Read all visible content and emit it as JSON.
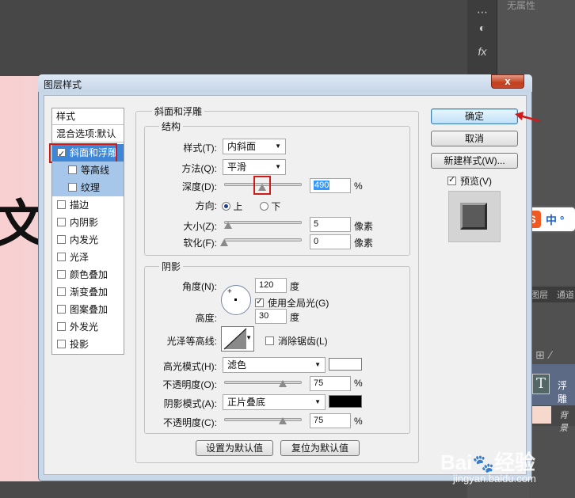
{
  "background": {
    "properties_label": "无属性",
    "canvas_char": "文",
    "panel_tabs": [
      "图层",
      "通道"
    ],
    "layer_name": "浮雕",
    "layer2_name": "背景",
    "sogou_text": "中 °"
  },
  "dialog": {
    "title": "图层样式",
    "close": "x",
    "styles_list": {
      "header": "样式",
      "blend_options": "混合选项:默认",
      "items": [
        {
          "label": "斜面和浮雕",
          "checked": true
        },
        {
          "label": "等高线",
          "checked": false
        },
        {
          "label": "纹理",
          "checked": false
        },
        {
          "label": "描边",
          "checked": false
        },
        {
          "label": "内阴影",
          "checked": false
        },
        {
          "label": "内发光",
          "checked": false
        },
        {
          "label": "光泽",
          "checked": false
        },
        {
          "label": "颜色叠加",
          "checked": false
        },
        {
          "label": "渐变叠加",
          "checked": false
        },
        {
          "label": "图案叠加",
          "checked": false
        },
        {
          "label": "外发光",
          "checked": false
        },
        {
          "label": "投影",
          "checked": false
        }
      ]
    },
    "bevel": {
      "section_title": "斜面和浮雕",
      "structure": {
        "title": "结构",
        "style_label": "样式(T):",
        "style_value": "内斜面",
        "technique_label": "方法(Q):",
        "technique_value": "平滑",
        "depth_label": "深度(D):",
        "depth_value": "490",
        "depth_unit": "%",
        "depth_slider_fraction": 0.49,
        "direction_label": "方向:",
        "direction_up": "上",
        "direction_down": "下",
        "direction_selected": "上",
        "size_label": "大小(Z):",
        "size_value": "5",
        "size_unit": "像素",
        "soften_label": "软化(F):",
        "soften_value": "0",
        "soften_unit": "像素"
      },
      "shading": {
        "title": "阴影",
        "angle_label": "角度(N):",
        "angle_value": "120",
        "angle_unit": "度",
        "global_light_label": "使用全局光(G)",
        "global_light_checked": true,
        "altitude_label": "高度:",
        "altitude_value": "30",
        "altitude_unit": "度",
        "gloss_contour_label": "光泽等高线:",
        "anti_alias_label": "消除锯齿(L)",
        "anti_alias_checked": false,
        "highlight_mode_label": "高光模式(H):",
        "highlight_mode_value": "滤色",
        "highlight_color": "#ffffff",
        "highlight_opacity_label": "不透明度(O):",
        "highlight_opacity_value": "75",
        "highlight_opacity_unit": "%",
        "shadow_mode_label": "阴影模式(A):",
        "shadow_mode_value": "正片叠底",
        "shadow_color": "#000000",
        "shadow_opacity_label": "不透明度(C):",
        "shadow_opacity_value": "75",
        "shadow_opacity_unit": "%"
      },
      "make_default": "设置为默认值",
      "reset_default": "复位为默认值"
    },
    "buttons": {
      "ok": "确定",
      "cancel": "取消",
      "new_style": "新建样式(W)...",
      "preview_label": "预览(V)",
      "preview_checked": true
    }
  },
  "watermark": {
    "brand": "Bai",
    "brand2": "经验",
    "url": "jingyan.baidu.com"
  },
  "colors": {
    "annotation_red": "#d01a1a",
    "selection_blue": "#3e87d6"
  }
}
